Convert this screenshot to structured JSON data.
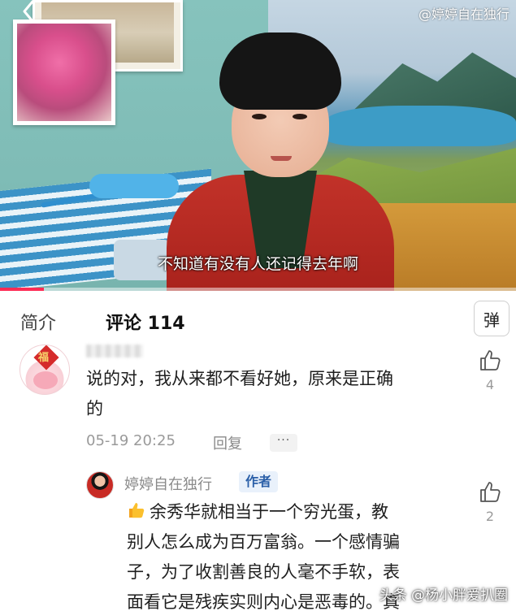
{
  "video": {
    "watermark": "@婷婷自在独行",
    "subtitle": "不知道有没有人还记得去年啊",
    "progress": 0.085
  },
  "tabs": {
    "intro_label": "简介",
    "comments_label": "评论 114",
    "danmu_label": "弹"
  },
  "comments": [
    {
      "text_line1": "说的对，我从来都不看好她，原来是正确",
      "text_line2": "的",
      "time": "05-19 20:25",
      "reply_label": "回复",
      "more_label": "···",
      "like_count": "4",
      "avatar_text": "福"
    }
  ],
  "author_reply": {
    "name": "婷婷自在独行",
    "badge": "作者",
    "line1": "余秀华就相当于一个穷光蛋，教",
    "line2": "别人怎么成为百万富翁。一个感情骗",
    "line3": "子，为了收割善良的人毫不手软，表",
    "line4": "面看它是残疾实则内心是恶毒的。真",
    "like_count": "2"
  },
  "footer": {
    "watermark": "头条 @杨小胖爱扒圈"
  },
  "colors": {
    "accent": "#fe2c55",
    "badge_bg": "#e9f1fb",
    "badge_text": "#2a5fa8",
    "jacket": "#c23229"
  },
  "icons": [
    "back-arrow-icon",
    "thumbs-up-icon",
    "thumbs-up-emoji-icon"
  ]
}
